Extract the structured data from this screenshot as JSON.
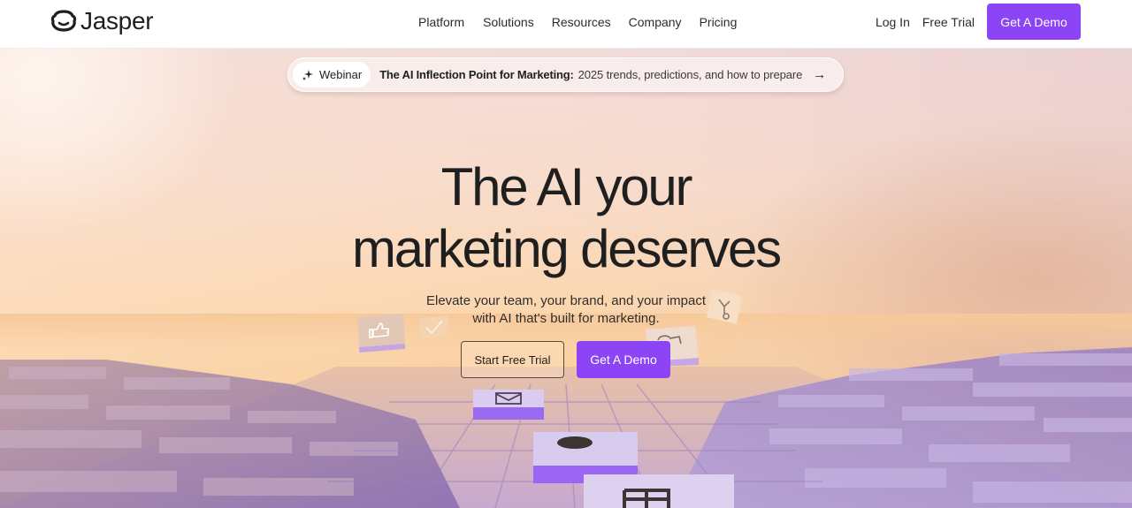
{
  "header": {
    "logo_text": "Jasper",
    "nav": [
      "Platform",
      "Solutions",
      "Resources",
      "Company",
      "Pricing"
    ],
    "login_label": "Log In",
    "free_trial_label": "Free Trial",
    "demo_label": "Get A Demo"
  },
  "announcement": {
    "tag_icon": "sparkle-icon",
    "tag_label": "Webinar",
    "title": "The AI Inflection Point for Marketing:",
    "description": "2025 trends, predictions, and how to prepare",
    "arrow_icon": "arrow-right-icon"
  },
  "hero": {
    "headline_line1": "The AI your",
    "headline_line2": "marketing deserves",
    "subhead_line1": "Elevate your team, your brand, and your impact",
    "subhead_line2": "with AI that's built for marketing.",
    "primary_cta": "Get A Demo",
    "secondary_cta": "Start Free Trial"
  },
  "decor": {
    "floating_tiles": [
      "thumbs-up-icon",
      "check-icon",
      "hubspot-icon",
      "workflow-icon",
      "mail-icon",
      "salesforce-icon",
      "grid-icon"
    ]
  },
  "colors": {
    "accent": "#8b45f5",
    "text": "#1f1f1f"
  }
}
